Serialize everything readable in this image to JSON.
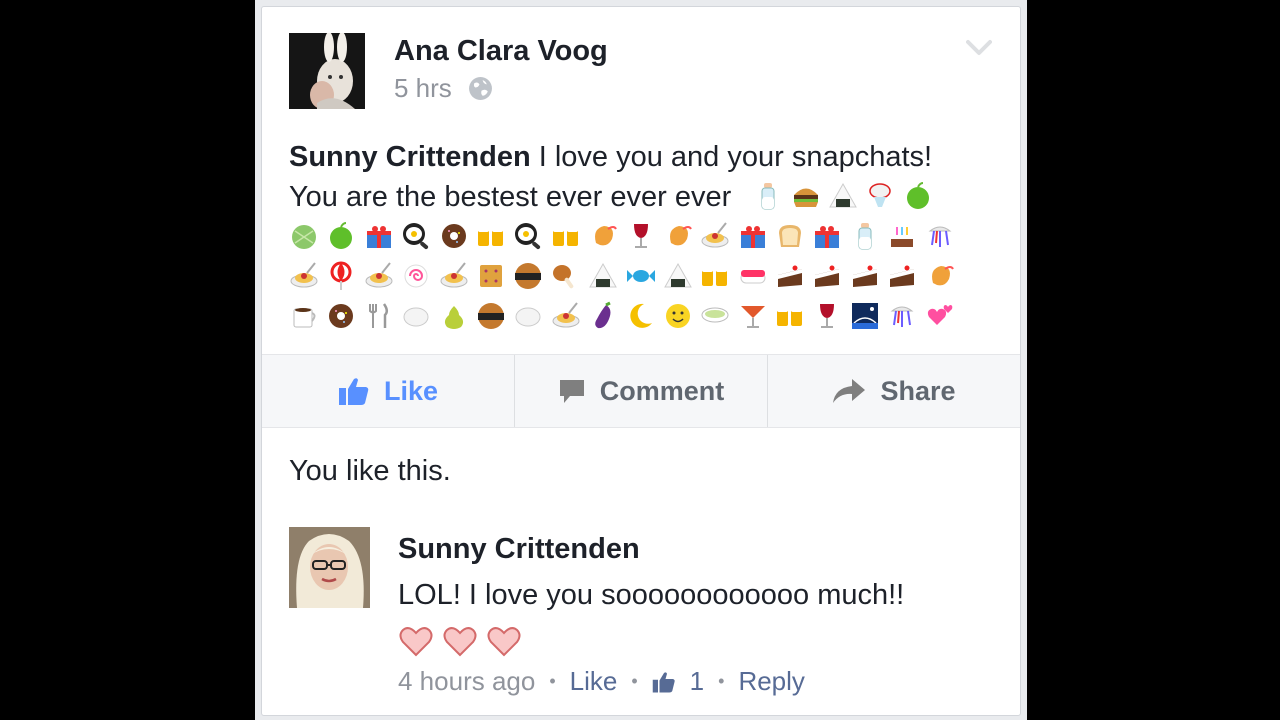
{
  "post": {
    "author": "Ana Clara Voog",
    "time": "5 hrs",
    "privacy_icon": "globe-icon",
    "mention": "Sunny Crittenden",
    "text_line1": " I love you and your snapchats!",
    "text_line2": "You are the bestest ever ever ever",
    "emoji_rows": [
      [
        "baby-bottle",
        "hamburger",
        "rice-ball",
        "shaved-ice",
        "green-apple"
      ],
      [
        "melon",
        "green-apple",
        "gift",
        "fried-egg",
        "doughnut",
        "beer-mugs",
        "fried-egg",
        "beer-mugs",
        "fried-shrimp",
        "wine-glass",
        "fried-shrimp",
        "spaghetti",
        "gift",
        "bread",
        "gift",
        "baby-bottle",
        "birthday-cake",
        "wind-chime"
      ],
      [
        "spaghetti",
        "lollipop",
        "spaghetti",
        "fish-cake",
        "spaghetti",
        "cracker",
        "rice-cracker",
        "poultry-leg",
        "rice-ball",
        "candy",
        "rice-ball",
        "beer-mugs",
        "sushi",
        "cake-slice",
        "cake-slice",
        "cake-slice",
        "cake-slice",
        "fried-shrimp"
      ],
      [
        "coffee",
        "doughnut",
        "fork-and-knife",
        "white-ball",
        "pear",
        "rice-cracker",
        "white-ball",
        "spaghetti",
        "eggplant",
        "crescent-moon",
        "smiley",
        "stew",
        "cocktail",
        "beer-mugs",
        "wine-glass",
        "night-bridge",
        "wind-chime",
        "two-hearts"
      ]
    ]
  },
  "actions": {
    "like": "Like",
    "comment": "Comment",
    "share": "Share"
  },
  "likes_summary": "You like this.",
  "comment": {
    "author": "Sunny Crittenden",
    "text": "LOL! I love you soooooooooooo much!!",
    "hearts": 3,
    "time": "4 hours ago",
    "like_label": "Like",
    "like_count": "1",
    "reply_label": "Reply"
  },
  "colors": {
    "like_blue": "#5890ff",
    "link": "#576b95",
    "muted": "#90949c"
  }
}
